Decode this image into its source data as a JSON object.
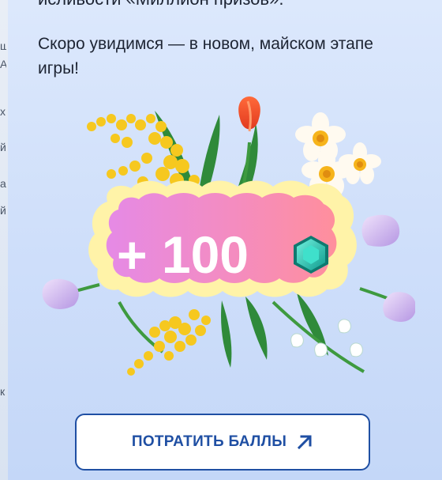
{
  "backdrop": {
    "glyphs": [
      "ш",
      "А",
      "х",
      "й",
      "а",
      "й",
      "к"
    ]
  },
  "modal": {
    "title_partial": "исливости «Миллион призов».",
    "message": "Скоро увидимся — в новом, майском этапе игры!",
    "reward": {
      "text": "+ 100",
      "icon": "gem-icon"
    },
    "button": {
      "label": "ПОТРАТИТЬ БАЛЛЫ",
      "icon": "arrow-up-right-icon"
    }
  },
  "colors": {
    "accent": "#1f4fa3",
    "badge_gradient_start": "#e58ae6",
    "badge_gradient_end": "#ff8f9c",
    "badge_border": "#fff3a8",
    "gem": "#1fbfae",
    "text": "#1d2433"
  }
}
